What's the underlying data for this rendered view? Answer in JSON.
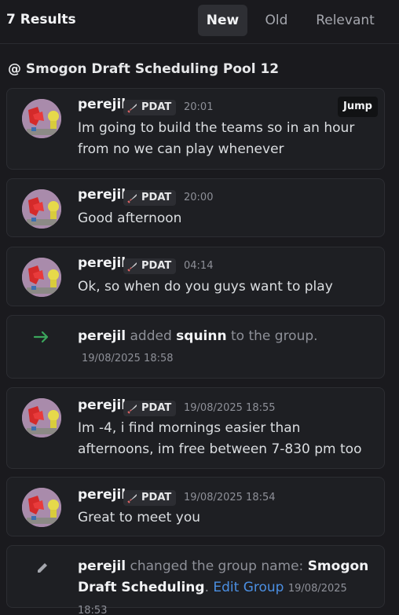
{
  "header": {
    "results": "7 Results",
    "tabs": [
      {
        "label": "New",
        "active": true
      },
      {
        "label": "Old",
        "active": false
      },
      {
        "label": "Relevant",
        "active": false
      }
    ]
  },
  "channel": "@ Smogon Draft Scheduling Pool 12",
  "jump_label": "Jump",
  "messages": [
    {
      "username": "perejil",
      "tag": "PDAT",
      "time": "20:01",
      "text": "Im going to build the teams so in an hour from no we can play whenever"
    },
    {
      "username": "perejil",
      "tag": "PDAT",
      "time": "20:00",
      "text": "Good afternoon"
    },
    {
      "username": "perejil",
      "tag": "PDAT",
      "time": "04:14",
      "text": "Ok, so when do you guys want to play"
    },
    {
      "username": "perejil",
      "tag": "PDAT",
      "time": "19/08/2025 18:55",
      "text": "Im -4, i find mornings easier than afternoons, im free between 7-830 pm too"
    },
    {
      "username": "perejil",
      "tag": "PDAT",
      "time": "19/08/2025 18:54",
      "text": "Great to meet you"
    }
  ],
  "system_added": {
    "actor": "perejil",
    "verb": "added",
    "target": "squinn",
    "suffix": "to the group.",
    "time": "19/08/2025 18:58",
    "icon": "arrow-right-icon"
  },
  "system_renamed": {
    "actor": "perejil",
    "verb": "changed the group name:",
    "name": "Smogon Draft Scheduling",
    "period": ".",
    "link": "Edit Group",
    "time": "19/08/2025 18:53",
    "icon": "pencil-icon"
  },
  "colors": {
    "background": "#1a1a1e",
    "card": "#1e1f23",
    "link": "#4b8fe2",
    "arrow": "#3ba55c"
  }
}
